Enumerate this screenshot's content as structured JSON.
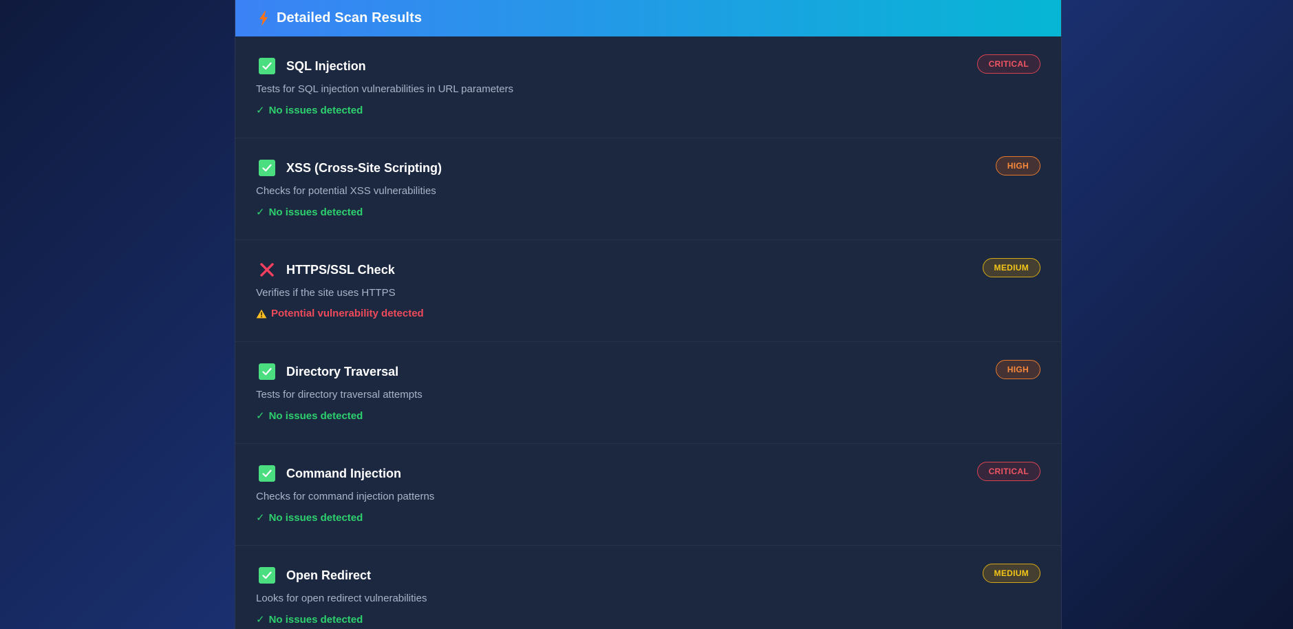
{
  "header": {
    "title": "Detailed Scan Results",
    "icon": "lightning-bolt-icon"
  },
  "colors": {
    "header_gradient_start": "#3b82f6",
    "header_gradient_end": "#06b6d4",
    "success": "#2ed06e",
    "failure": "#ef4a5a",
    "critical": "#f05561",
    "high": "#fb8a3c",
    "medium": "#f5c518"
  },
  "results": [
    {
      "name": "SQL Injection",
      "severity": "CRITICAL",
      "severity_level": "critical",
      "description": "Tests for SQL injection vulnerabilities in URL parameters",
      "status": "pass",
      "status_icon": "check-box-icon",
      "result_mark": "✓",
      "result_text": "No issues detected"
    },
    {
      "name": "XSS (Cross-Site Scripting)",
      "severity": "HIGH",
      "severity_level": "high",
      "description": "Checks for potential XSS vulnerabilities",
      "status": "pass",
      "status_icon": "check-box-icon",
      "result_mark": "✓",
      "result_text": "No issues detected"
    },
    {
      "name": "HTTPS/SSL Check",
      "severity": "MEDIUM",
      "severity_level": "medium",
      "description": "Verifies if the site uses HTTPS",
      "status": "fail",
      "status_icon": "cross-icon",
      "result_mark": "warning-icon",
      "result_text": "Potential vulnerability detected"
    },
    {
      "name": "Directory Traversal",
      "severity": "HIGH",
      "severity_level": "high",
      "description": "Tests for directory traversal attempts",
      "status": "pass",
      "status_icon": "check-box-icon",
      "result_mark": "✓",
      "result_text": "No issues detected"
    },
    {
      "name": "Command Injection",
      "severity": "CRITICAL",
      "severity_level": "critical",
      "description": "Checks for command injection patterns",
      "status": "pass",
      "status_icon": "check-box-icon",
      "result_mark": "✓",
      "result_text": "No issues detected"
    },
    {
      "name": "Open Redirect",
      "severity": "MEDIUM",
      "severity_level": "medium",
      "description": "Looks for open redirect vulnerabilities",
      "status": "pass",
      "status_icon": "check-box-icon",
      "result_mark": "✓",
      "result_text": "No issues detected"
    }
  ]
}
